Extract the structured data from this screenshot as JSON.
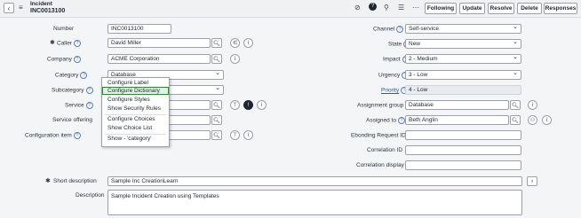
{
  "header": {
    "record_type": "Incident",
    "record_number": "INC0013100",
    "buttons": {
      "following": "Following",
      "update": "Update",
      "resolve": "Resolve",
      "delete": "Delete",
      "responses": "Responses"
    },
    "icons": [
      "paperclip-icon",
      "question-icon",
      "activity-icon",
      "settings-icon",
      "more-icon"
    ]
  },
  "left": {
    "number": {
      "label": "Number",
      "value": "INC0013100"
    },
    "caller": {
      "label": "Caller",
      "value": "David Miller"
    },
    "company": {
      "label": "Company",
      "value": "ACME Corporation"
    },
    "category": {
      "label": "Category",
      "value": "Database"
    },
    "subcategory": {
      "label": "Subcategory",
      "value": ""
    },
    "service": {
      "label": "Service",
      "value": ""
    },
    "service_offering": {
      "label": "Service offering",
      "value": ""
    },
    "configuration_item": {
      "label": "Configuration item",
      "value": ""
    }
  },
  "right": {
    "channel": {
      "label": "Channel",
      "value": "Self-service"
    },
    "state": {
      "label": "State",
      "value": "New"
    },
    "impact": {
      "label": "Impact",
      "value": "2 - Medium"
    },
    "urgency": {
      "label": "Urgency",
      "value": "3 - Low"
    },
    "priority": {
      "label": "Priority",
      "value": "4 - Low"
    },
    "assignment_group": {
      "label": "Assignment group",
      "value": "Database"
    },
    "assigned_to": {
      "label": "Assigned to",
      "value": "Beth Anglin"
    },
    "ebonding": {
      "label": "Ebonding Request ID",
      "value": ""
    },
    "correlation_id": {
      "label": "Correlation ID",
      "value": ""
    },
    "correlation_display": {
      "label": "Correlation display",
      "value": ""
    }
  },
  "bottom": {
    "short_description": {
      "label": "Short description",
      "value": "Sample Inc CreationLearn"
    },
    "description": {
      "label": "Description",
      "value": "Sample Incident Creation using Templates"
    }
  },
  "context_menu": {
    "items": [
      "Configure Label",
      "Configure Dictionary",
      "Configure Styles",
      "Show Security Rules",
      "Configure Choices",
      "Show Choice List",
      "Show - 'category'"
    ],
    "highlighted": "Configure Dictionary"
  }
}
